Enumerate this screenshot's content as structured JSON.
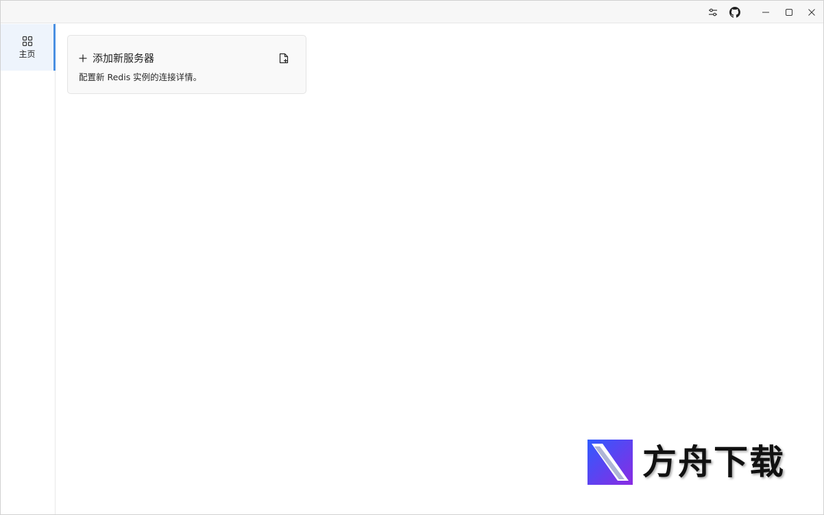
{
  "titlebar": {
    "icons": [
      "settings-sliders-icon",
      "github-icon"
    ],
    "window_controls": [
      "minimize-icon",
      "maximize-icon",
      "close-icon"
    ]
  },
  "sidebar": {
    "items": [
      {
        "label": "主页",
        "icon": "grid-icon",
        "active": true
      }
    ],
    "accent_color": "#4a90e2"
  },
  "main": {
    "card": {
      "title": "添加新服务器",
      "description": "配置新 Redis 实例的连接详情。",
      "icons": [
        "plus-icon",
        "file-add-icon"
      ]
    }
  },
  "watermark": {
    "text": "方舟下载"
  }
}
